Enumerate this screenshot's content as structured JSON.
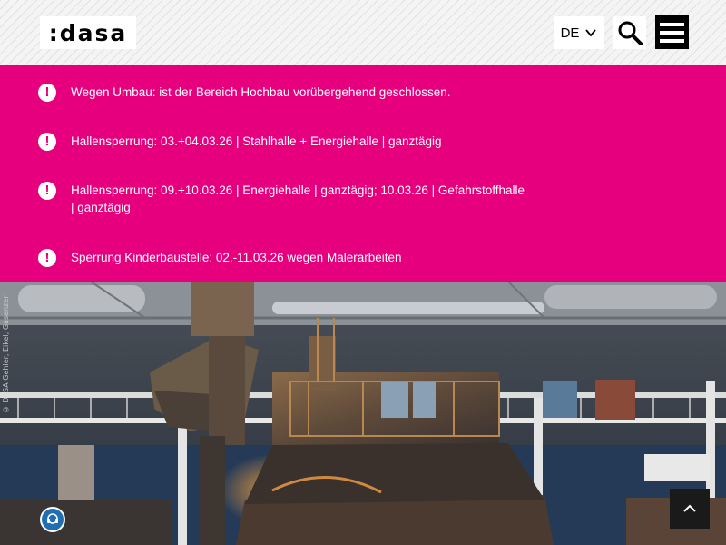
{
  "header": {
    "logo_text": ":dasa",
    "language": "DE",
    "search_icon": "search-icon",
    "menu_icon": "hamburger-icon"
  },
  "notices": [
    {
      "icon": "exclamation-icon",
      "text": "Wegen Umbau: ist der Bereich Hochbau vorübergehend geschlossen."
    },
    {
      "icon": "exclamation-icon",
      "text": "Hallensperrung: 03.+04.03.26 | Stahlhalle + Energiehalle | ganztägig"
    },
    {
      "icon": "exclamation-icon",
      "text": "Hallensperrung: 09.+10.03.26 | Energiehalle | ganztägig; 10.03.26 | Gefahrstoffhalle | ganztägig"
    },
    {
      "icon": "exclamation-icon",
      "text": "Sperrung Kinderbaustelle: 02.-11.03.26 wegen Malerarbeiten"
    }
  ],
  "hero": {
    "credit": "© DASA Gehler, Eikel, Gasenzer",
    "badge_icon": "ear-protection-icon",
    "back_to_top_icon": "chevron-up-icon"
  },
  "colors": {
    "accent": "#e6007e",
    "header_bg": "#f4f4f4",
    "menu_bg": "#000000"
  }
}
